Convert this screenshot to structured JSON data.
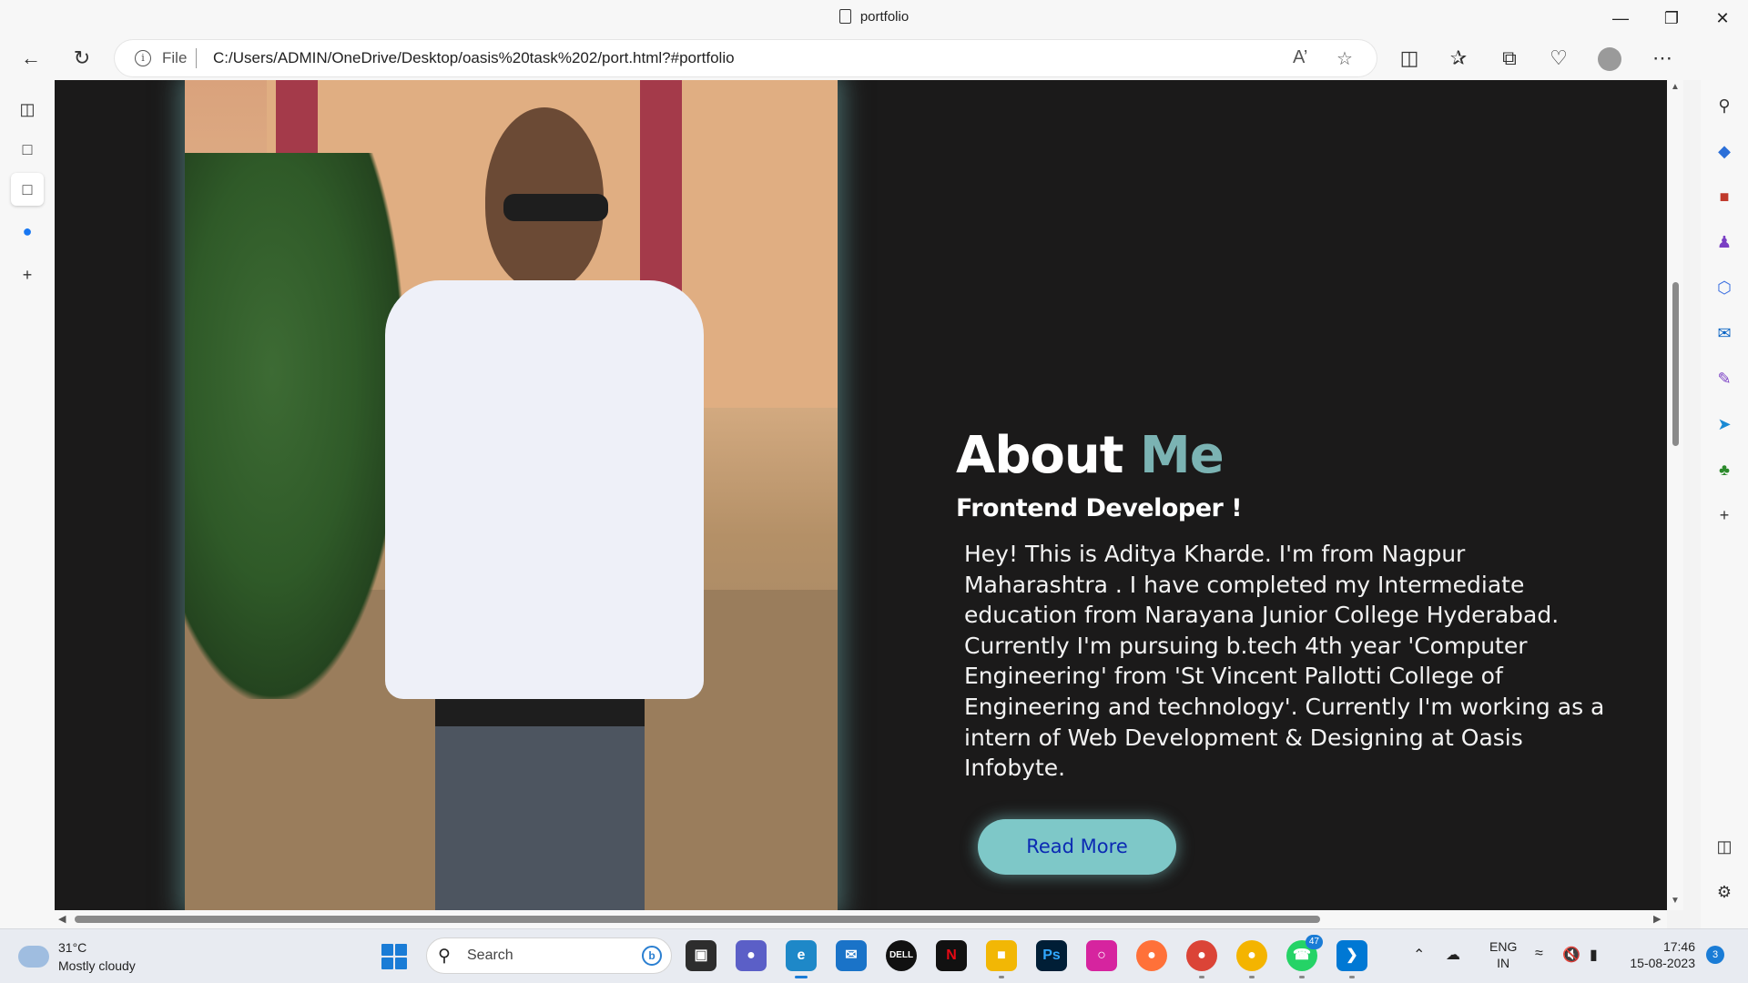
{
  "window": {
    "title": "portfolio"
  },
  "toolbar": {
    "file_label": "File",
    "url": "C:/Users/ADMIN/OneDrive/Desktop/oasis%20task%202/port.html?#portfolio"
  },
  "page": {
    "heading_part1": "About",
    "heading_part2": "Me",
    "subheading": "Frontend Developer !",
    "bio": "Hey! This is Aditya Kharde. I'm from Nagpur Maharashtra . I have completed my Intermediate education from Narayana Junior College Hyderabad. Currently I'm pursuing b.tech 4th year 'Computer Engineering' from 'St Vincent Pallotti College of Engineering and technology'. Currently I'm working as a intern of Web Development & Designing at Oasis Infobyte.",
    "button_label": "Read More",
    "accent_color": "#7bb3b3",
    "button_color": "#7ec8c8"
  },
  "taskbar": {
    "weather_temp": "31°C",
    "weather_desc": "Mostly cloudy",
    "search_placeholder": "Search",
    "whatsapp_badge": "47",
    "lang_line1": "ENG",
    "lang_line2": "IN",
    "time": "17:46",
    "date": "15-08-2023",
    "notifications": "3"
  }
}
